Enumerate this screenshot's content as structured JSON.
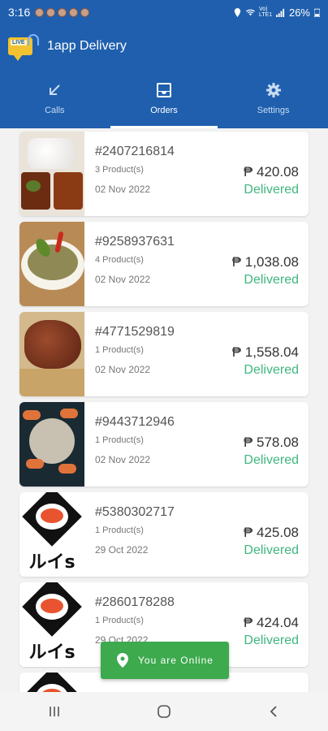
{
  "status_bar": {
    "time": "3:16",
    "battery": "26%",
    "network": "Vo) LTE1"
  },
  "app": {
    "title": "1app Delivery",
    "logo_badge": "LIVE"
  },
  "tabs": [
    {
      "label": "Calls",
      "icon": "incoming-call-arrow-icon",
      "active": false
    },
    {
      "label": "Orders",
      "icon": "inbox-icon",
      "active": true
    },
    {
      "label": "Settings",
      "icon": "gear-icon",
      "active": false
    }
  ],
  "orders": [
    {
      "id": "#2407216814",
      "products": "3 Product(s)",
      "date": "02 Nov 2022",
      "price": "₱ 420.08",
      "status": "Delivered",
      "thumb": "rice-meal"
    },
    {
      "id": "#9258937631",
      "products": "4 Product(s)",
      "date": "02 Nov 2022",
      "price": "₱ 1,038.08",
      "status": "Delivered",
      "thumb": "soup-bowl"
    },
    {
      "id": "#4771529819",
      "products": "1 Product(s)",
      "date": "02 Nov 2022",
      "price": "₱ 1,558.04",
      "status": "Delivered",
      "thumb": "roast-pork"
    },
    {
      "id": "#9443712946",
      "products": "1 Product(s)",
      "date": "02 Nov 2022",
      "price": "₱ 578.08",
      "status": "Delivered",
      "thumb": "seafood-platter"
    },
    {
      "id": "#5380302717",
      "products": "1 Product(s)",
      "date": "29 Oct 2022",
      "price": "₱ 425.08",
      "status": "Delivered",
      "thumb": "sushi-logo"
    },
    {
      "id": "#2860178288",
      "products": "1 Product(s)",
      "date": "29 Oct 2022",
      "price": "₱ 424.04",
      "status": "Delivered",
      "thumb": "sushi-logo"
    }
  ],
  "sushi_brand": "ルイs",
  "toast": {
    "text": "You are Online"
  },
  "colors": {
    "primary": "#1f5fae",
    "delivered": "#3fb67f",
    "toast": "#3caa4d"
  }
}
